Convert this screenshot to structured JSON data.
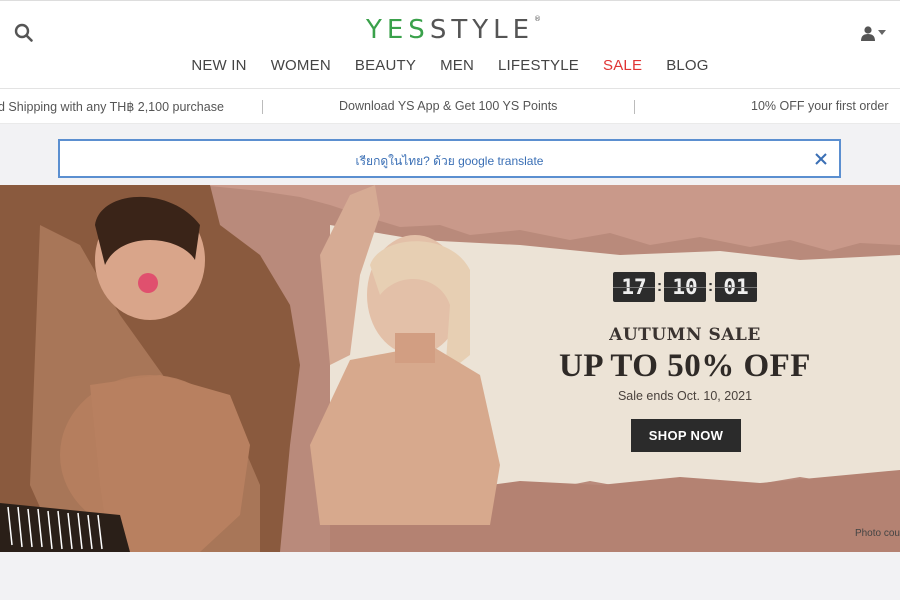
{
  "header": {
    "logo_yes": "YES",
    "logo_style": "STYLE",
    "logo_mark": "®"
  },
  "nav": {
    "items": [
      {
        "label": "NEW IN"
      },
      {
        "label": "WOMEN"
      },
      {
        "label": "BEAUTY"
      },
      {
        "label": "MEN"
      },
      {
        "label": "LIFESTYLE"
      },
      {
        "label": "SALE"
      },
      {
        "label": "BLOG"
      }
    ]
  },
  "promo": {
    "items": [
      "d Shipping with any TH฿ 2,100 purchase",
      "Download YS App & Get 100 YS Points",
      "10% OFF your first order"
    ]
  },
  "translate_bar": {
    "message": "เรียกดูในไทย? ด้วย google translate"
  },
  "hero": {
    "countdown": {
      "hours": "17",
      "minutes": "10",
      "seconds": "01"
    },
    "subtitle": "AUTUMN SALE",
    "headline": "UP TO 50% OFF",
    "ends": "Sale ends Oct. 10, 2021",
    "cta": "SHOP NOW",
    "credit": "Photo cou"
  },
  "colors": {
    "brand_green": "#3aa14b",
    "sale_red": "#e03434",
    "translate_border": "#5b8fd0",
    "button_dark": "#2b2b2b"
  },
  "icons": [
    "search-icon",
    "user-icon",
    "chevron-down-icon",
    "close-icon"
  ]
}
